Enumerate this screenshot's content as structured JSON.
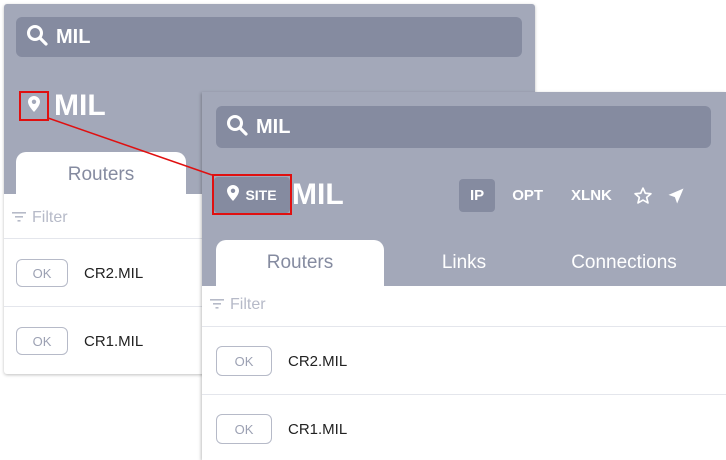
{
  "back_panel": {
    "search": {
      "query": "MIL"
    },
    "site_title": "MIL",
    "tabs": [
      {
        "label": "Routers"
      }
    ],
    "filter_placeholder": "Filter",
    "routers": [
      {
        "status": "OK",
        "name": "CR2.MIL"
      },
      {
        "status": "OK",
        "name": "CR1.MIL"
      }
    ]
  },
  "front_panel": {
    "search": {
      "query": "MIL"
    },
    "site_badge": "SITE",
    "site_title": "MIL",
    "toolbar": {
      "ip": "IP",
      "opt": "OPT",
      "xlnk": "XLNK"
    },
    "tabs": [
      {
        "label": "Routers"
      },
      {
        "label": "Links"
      },
      {
        "label": "Connections"
      }
    ],
    "filter_placeholder": "Filter",
    "routers": [
      {
        "status": "OK",
        "name": "CR2.MIL"
      },
      {
        "status": "OK",
        "name": "CR1.MIL"
      }
    ]
  },
  "colors": {
    "header": "#a3a8b9",
    "search": "#858ba0",
    "highlight": "#e01010"
  },
  "icons": [
    "search-icon",
    "pin-icon",
    "filter-icon",
    "star-icon",
    "navigate-icon"
  ]
}
